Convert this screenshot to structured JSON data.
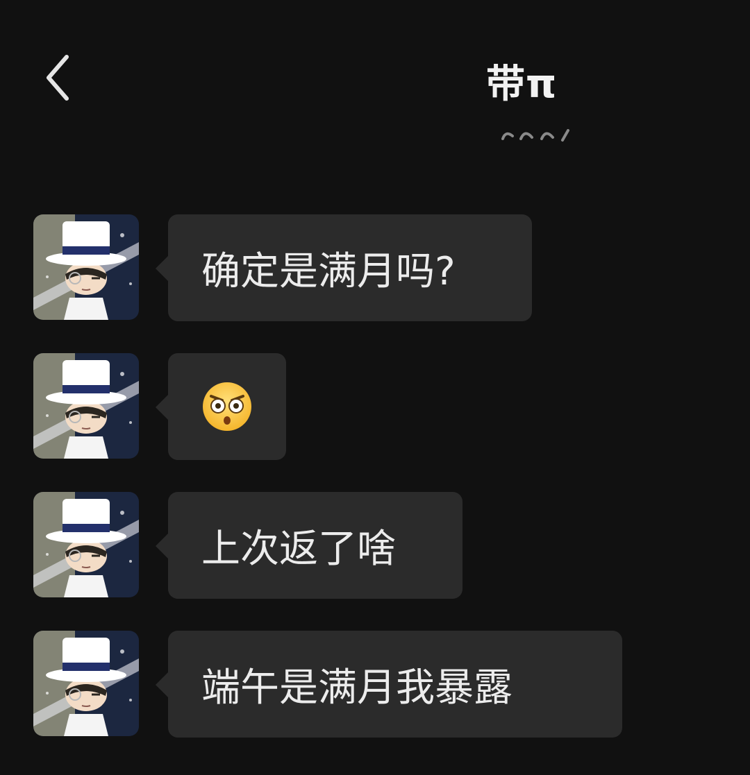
{
  "header": {
    "title": "带π"
  },
  "messages": [
    {
      "type": "text",
      "text": "确定是满月吗?"
    },
    {
      "type": "emoji",
      "emoji_name": "surprised-angry-face-icon"
    },
    {
      "type": "text",
      "text": "上次返了啥"
    },
    {
      "type": "text",
      "text": "端午是满月我暴露"
    }
  ],
  "colors": {
    "background": "#111111",
    "bubble": "#2b2b2b",
    "text": "#ececec",
    "hat": "#ffffff",
    "hat_band": "#23306b"
  }
}
